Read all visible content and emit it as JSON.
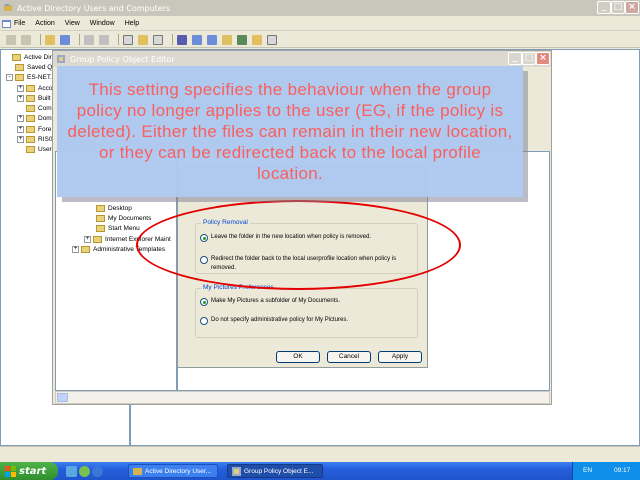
{
  "ad_window": {
    "title": "Active Directory Users and Computers",
    "menu": [
      "File",
      "Action",
      "View",
      "Window",
      "Help"
    ],
    "tree": [
      {
        "label": "Active Direct",
        "expander": ""
      },
      {
        "label": "Saved Q",
        "expander": ""
      },
      {
        "label": "ES-NET.C",
        "expander": "-"
      },
      {
        "label": "Acco",
        "expander": "+"
      },
      {
        "label": "Built",
        "expander": "+"
      },
      {
        "label": "Comp",
        "expander": ""
      },
      {
        "label": "Dom",
        "expander": "+"
      },
      {
        "label": "Fore",
        "expander": "+"
      },
      {
        "label": "RIS0",
        "expander": "+"
      },
      {
        "label": "User",
        "expander": ""
      }
    ]
  },
  "gpo_window": {
    "title": "Group Policy Object Editor",
    "tree": [
      {
        "label": "Desktop",
        "indent": 40
      },
      {
        "label": "My Documents",
        "indent": 40
      },
      {
        "label": "Start Menu",
        "indent": 40
      },
      {
        "label": "Internet Explorer Maint",
        "indent": 28,
        "expander": "+"
      },
      {
        "label": "Administrative Templates",
        "indent": 16,
        "expander": "+"
      }
    ]
  },
  "dialog": {
    "policy_removal": {
      "legend": "Policy Removal",
      "option1": "Leave the folder in the new location when policy is removed.",
      "option2": "Redirect the folder back to the local userprofile location when policy is removed.",
      "selected": 1
    },
    "my_pictures": {
      "legend": "My Pictures Preferences",
      "option1": "Make My Pictures a subfolder of My Documents.",
      "option2": "Do not specify administrative policy for My Pictures.",
      "selected": 1
    },
    "buttons": {
      "ok": "OK",
      "cancel": "Cancel",
      "apply": "Apply"
    }
  },
  "callout": {
    "text": "This setting specifies the behaviour when the group policy no longer applies to the user (EG, if the policy is deleted). Either the files can remain in their new location, or they can be redirected back to the local profile location."
  },
  "taskbar": {
    "start_label": "start",
    "tasks": [
      "Active Directory User...",
      "Group Policy Object E..."
    ],
    "language": "EN",
    "clock": "09:17"
  },
  "colors": {
    "callout_bg": "#afcaf0",
    "callout_text": "#fb5a5a",
    "highlight": "#e20000",
    "taskbar": "#245edb"
  }
}
